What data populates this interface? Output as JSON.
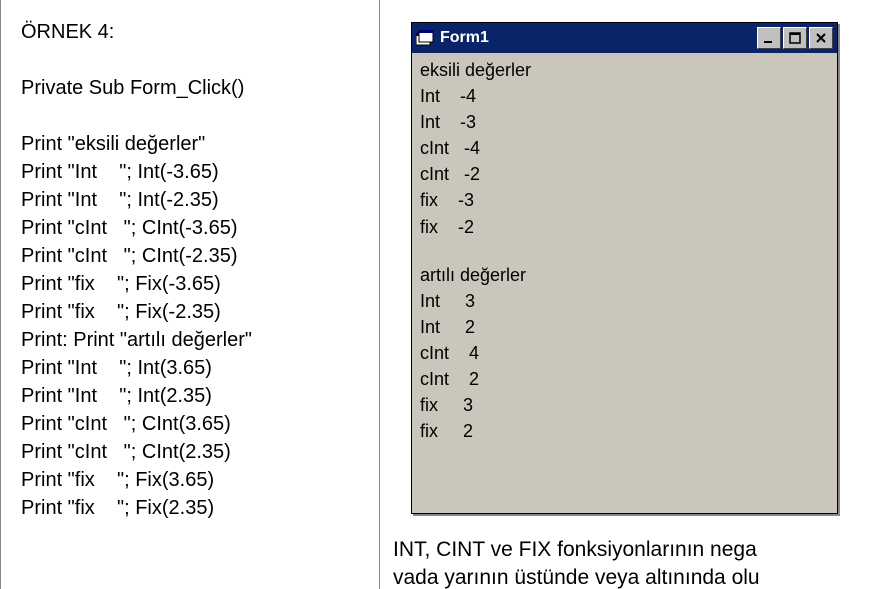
{
  "left": {
    "heading": "ÖRNEK 4:",
    "sub_declaration": "Private Sub Form_Click()",
    "code": [
      "Print \"eksili değerler\"",
      "Print \"Int    \"; Int(-3.65)",
      "Print \"Int    \"; Int(-2.35)",
      "Print \"cInt   \"; CInt(-3.65)",
      "Print \"cInt   \"; CInt(-2.35)",
      "Print \"fix    \"; Fix(-3.65)",
      "Print \"fix    \"; Fix(-2.35)",
      "Print: Print \"artılı değerler\"",
      "Print \"Int    \"; Int(3.65)",
      "Print \"Int    \"; Int(2.35)",
      "Print \"cInt   \"; CInt(3.65)",
      "Print \"cInt   \"; CInt(2.35)",
      "Print \"fix    \"; Fix(3.65)",
      "Print \"fix    \"; Fix(2.35)"
    ]
  },
  "window": {
    "title": "Form1",
    "output_top_header": "eksili değerler",
    "output_top": [
      "Int    -4",
      "Int    -3",
      "cInt   -4",
      "cInt   -2",
      "fix    -3",
      "fix    -2"
    ],
    "output_bottom_header": "artılı değerler",
    "output_bottom": [
      "Int     3",
      "Int     2",
      "cInt    4",
      "cInt    2",
      "fix     3",
      "fix     2"
    ]
  },
  "bottom": {
    "line1": "INT, CINT ve FIX fonksiyonlarının nega",
    "line2": "vada yarının üstünde veya altınında olu"
  }
}
